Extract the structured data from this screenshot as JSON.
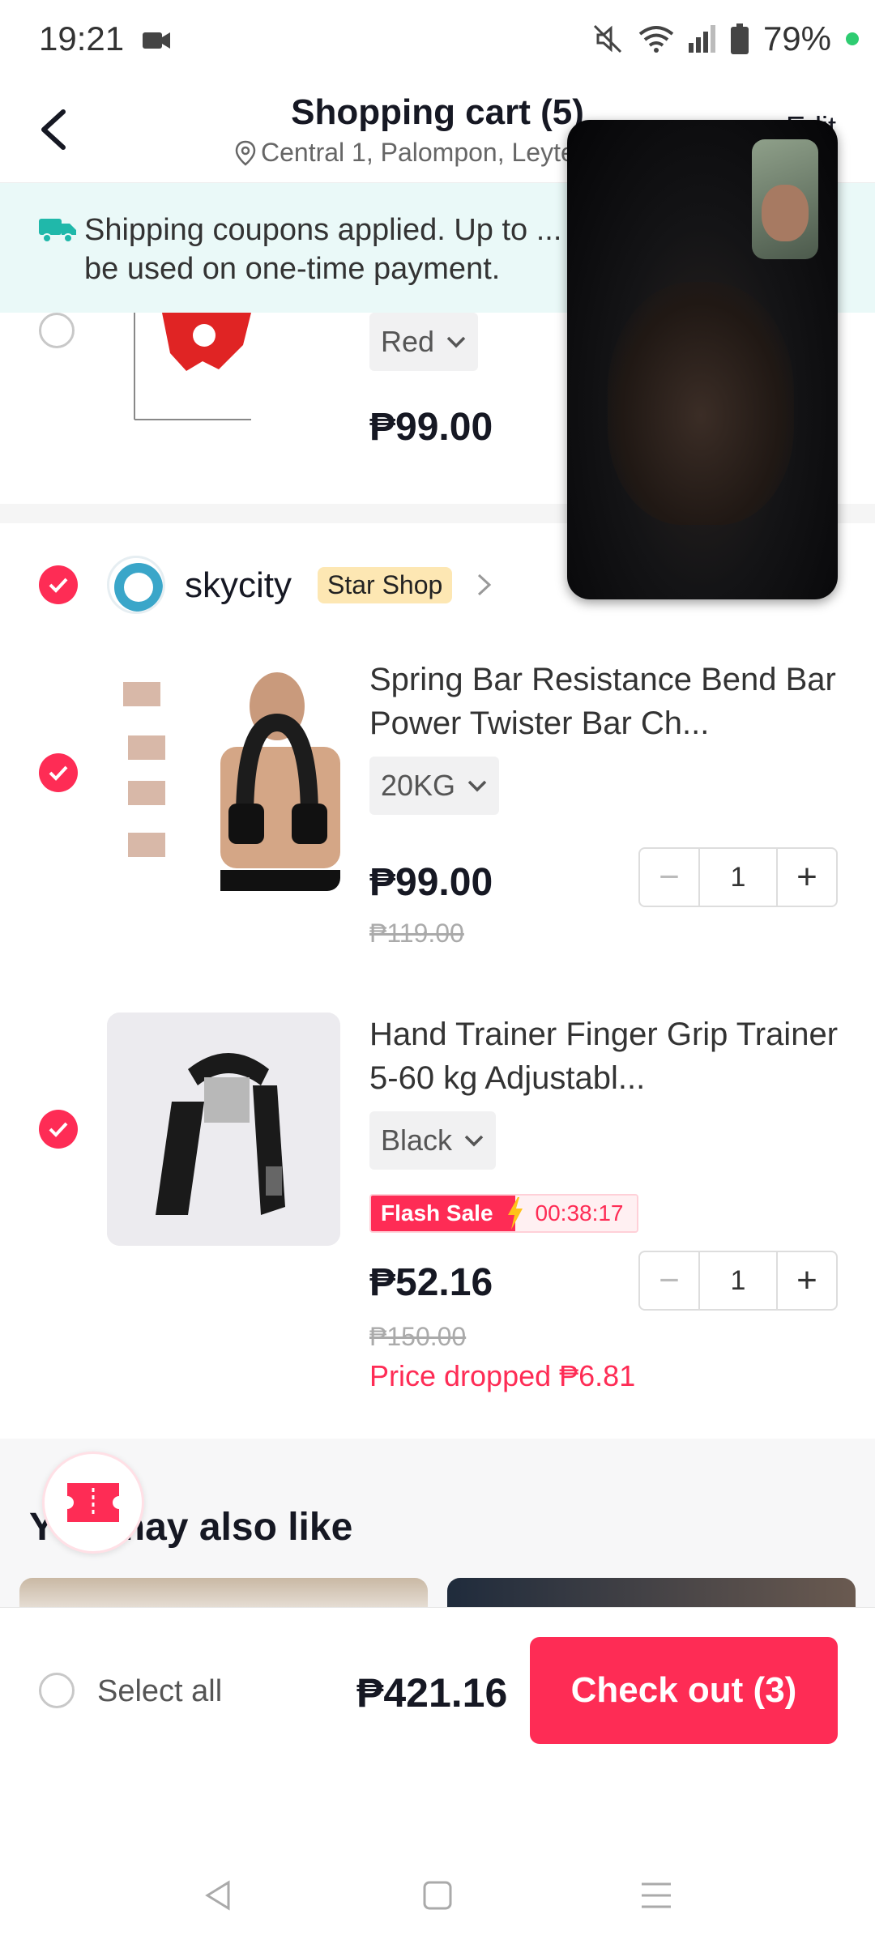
{
  "status_bar": {
    "time": "19:21",
    "battery": "79%"
  },
  "header": {
    "title": "Shopping cart (5)",
    "location": "Central 1, Palompon, Leyte",
    "edit": "Edit"
  },
  "banner": {
    "text": "Shipping coupons applied. Up to ... be used on one-time payment."
  },
  "item0": {
    "variant": "Red",
    "price": "₱99.00"
  },
  "shop": {
    "name": "skycity",
    "badge": "Star Shop"
  },
  "products": [
    {
      "title": "Spring Bar Resistance Bend Bar Power Twister Bar Ch...",
      "variant": "20KG",
      "price": "₱99.00",
      "original_price": "₱119.00",
      "qty": "1"
    },
    {
      "title": "Hand Trainer Finger Grip Trainer 5-60 kg Adjustabl...",
      "variant": "Black",
      "flash_label": "Flash Sale",
      "flash_timer": "00:38:17",
      "price": "₱52.16",
      "original_price": "₱150.00",
      "price_drop": "Price dropped ₱6.81",
      "qty": "1"
    }
  ],
  "recommendations": {
    "title": "You may also like"
  },
  "bottom_bar": {
    "select_all": "Select all",
    "total": "₱421.16",
    "checkout": "Check out (3)"
  },
  "colors": {
    "accent": "#fe2c55",
    "banner_bg": "#eaf9f8",
    "badge_bg": "#fde7b3"
  }
}
